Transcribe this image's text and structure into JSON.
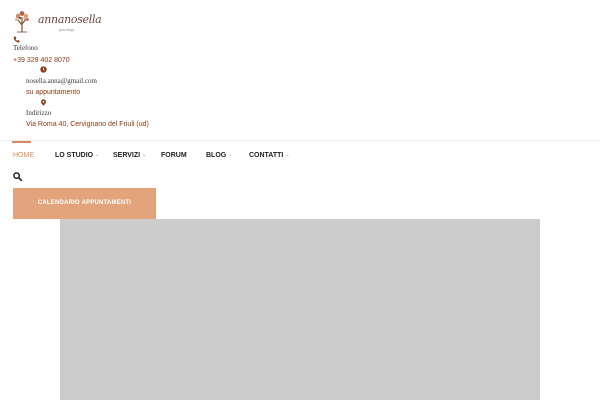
{
  "brand": {
    "logo_text": "annanosella",
    "logo_subtext": "psicologa",
    "tree_icon": "tree-logo-icon"
  },
  "contact": {
    "phone_label": "Telefono",
    "phone_value": "+39 329 402 8070",
    "email_value": "nosella.anna@gmail.com",
    "appointment_text": "su appuntamento",
    "address_label": "Indirizzo",
    "address_value": "Via Roma 40, Cervignano del Friuli (ud)",
    "icons": [
      "phone-icon",
      "clock-icon",
      "location-pin-icon"
    ]
  },
  "nav": {
    "items": [
      {
        "label": "HOME",
        "active": true,
        "has_dropdown": false
      },
      {
        "label": "LO STUDIO",
        "active": false,
        "has_dropdown": true
      },
      {
        "label": "SERVIZI",
        "active": false,
        "has_dropdown": true
      },
      {
        "label": "FORUM",
        "active": false,
        "has_dropdown": false
      },
      {
        "label": "BLOG",
        "active": false,
        "has_dropdown": true
      },
      {
        "label": "CONTATTI",
        "active": false,
        "has_dropdown": true
      }
    ],
    "chevron": "⌄"
  },
  "search": {
    "icon": "search-icon"
  },
  "cta": {
    "label": "CALENDARIO APPUNTAMENTI"
  },
  "colors": {
    "accent": "#d98a5c",
    "button": "#e3a47b",
    "contact_value": "#8a3a12",
    "hero_placeholder": "#cccccc"
  }
}
